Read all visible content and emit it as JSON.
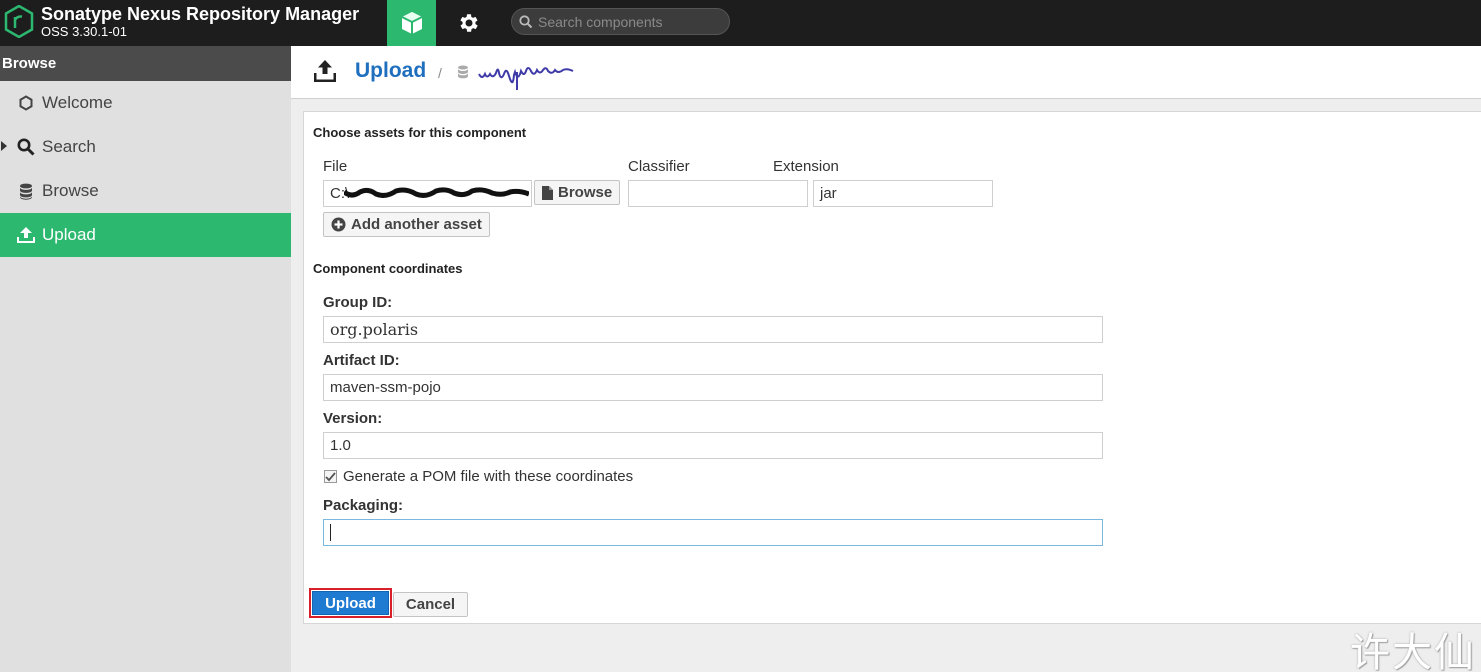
{
  "header": {
    "title": "Sonatype Nexus Repository Manager",
    "version": "OSS 3.30.1-01",
    "search_placeholder": "Search components"
  },
  "sidebar": {
    "section": "Browse",
    "items": [
      {
        "label": "Welcome",
        "icon": "hexagon-icon",
        "active": false
      },
      {
        "label": "Search",
        "icon": "search-icon",
        "active": false
      },
      {
        "label": "Browse",
        "icon": "database-icon",
        "active": false
      },
      {
        "label": "Upload",
        "icon": "upload-icon",
        "active": true
      }
    ]
  },
  "breadcrumb": {
    "title": "Upload",
    "separator": "/"
  },
  "assets": {
    "section_title": "Choose assets for this component",
    "col_file": "File",
    "col_classifier": "Classifier",
    "col_extension": "Extension",
    "file_value_prefix": "C:\\",
    "classifier_value": "",
    "extension_value": "jar",
    "browse_label": "Browse",
    "add_asset_label": "Add another asset"
  },
  "coordinates": {
    "section_title": "Component coordinates",
    "group_label": "Group ID:",
    "group_value": "org.polaris",
    "artifact_label": "Artifact ID:",
    "artifact_value": "maven-ssm-pojo",
    "version_label": "Version:",
    "version_value": "1.0",
    "generate_pom_label": "Generate a POM file with these coordinates",
    "generate_pom_checked": true,
    "packaging_label": "Packaging:",
    "packaging_value": ""
  },
  "actions": {
    "upload_label": "Upload",
    "cancel_label": "Cancel"
  },
  "watermark": "许大仙",
  "colors": {
    "accent_green": "#2db870",
    "link_blue": "#1f6fbf",
    "primary_button": "#1f7ad1",
    "highlight_red": "#d9202a"
  }
}
